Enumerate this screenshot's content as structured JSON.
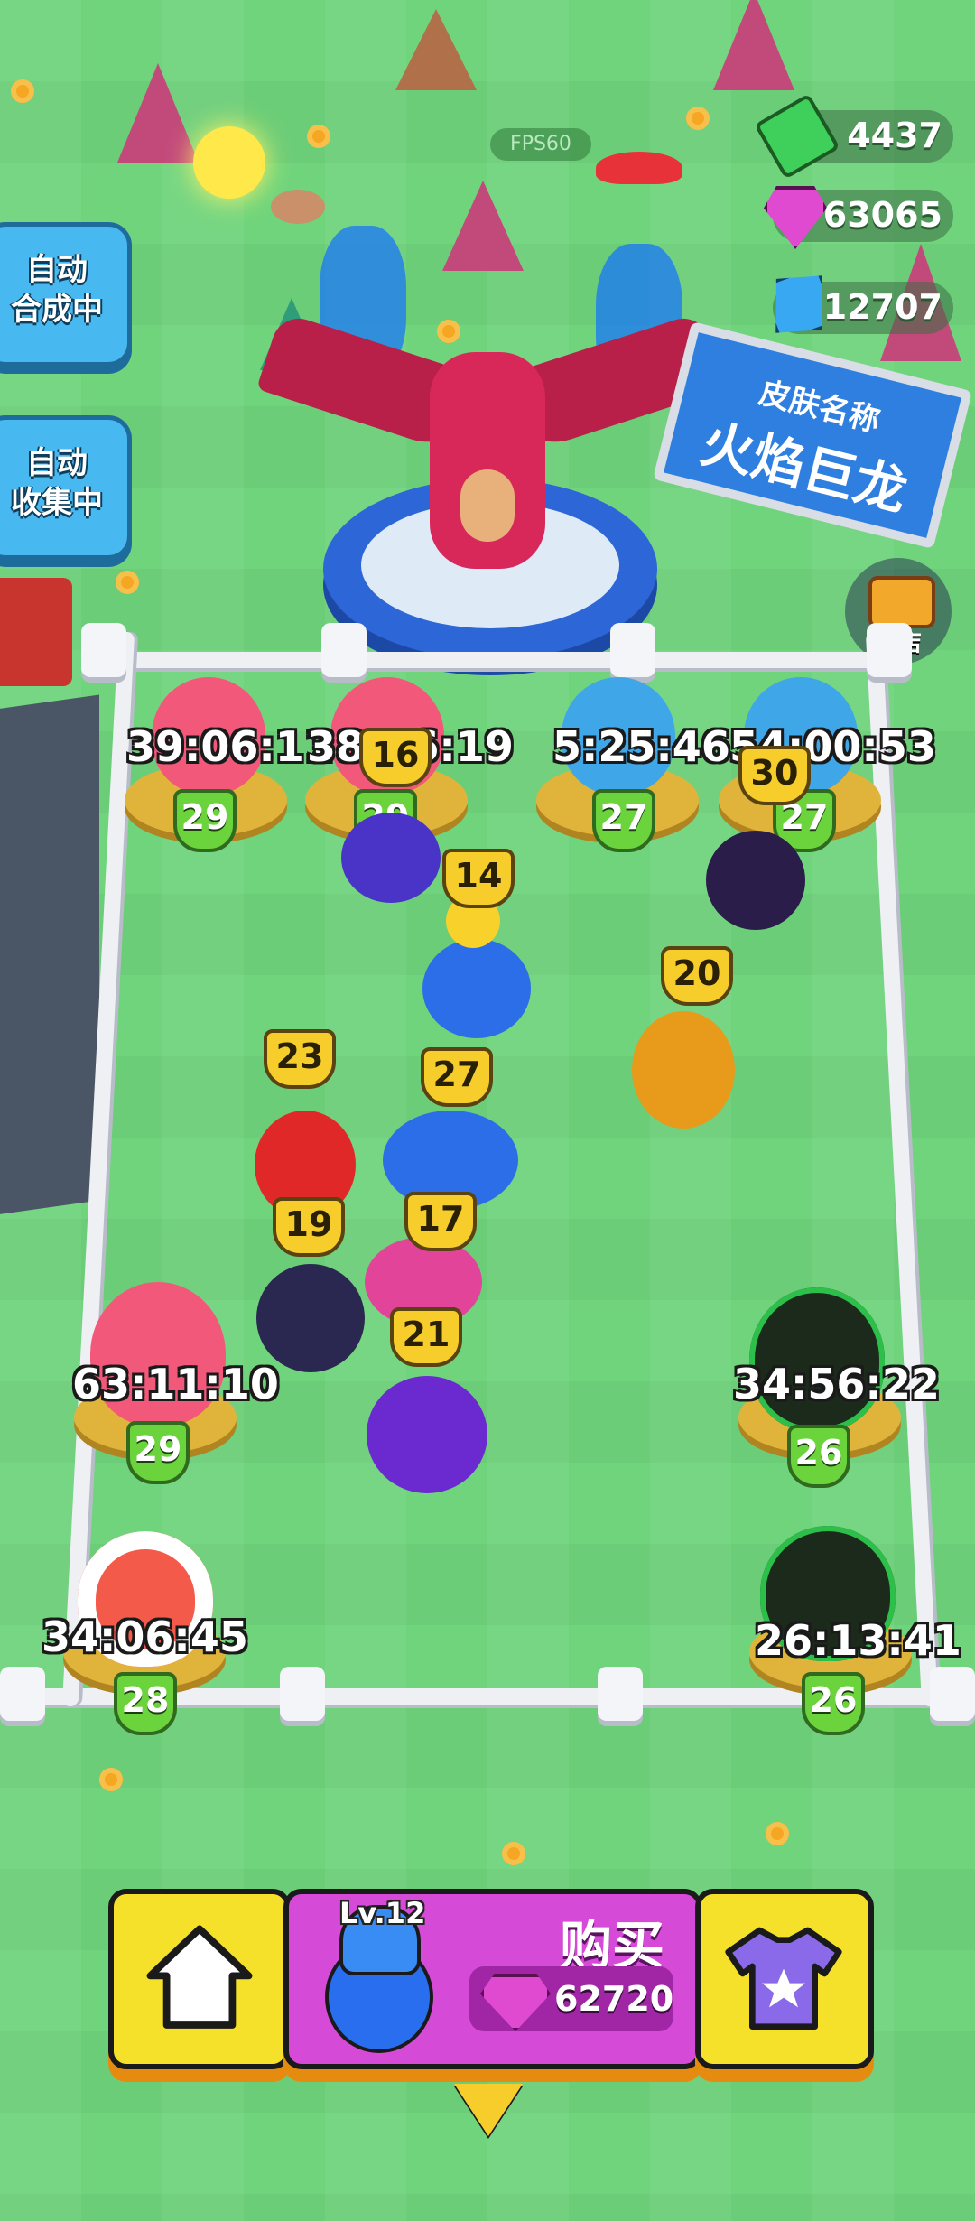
{
  "hud": {
    "fps": "FPS60",
    "cash": "4437",
    "pink_gems": "63065",
    "blue_crystals": "12707",
    "cash_icon": "cash-icon",
    "pink_gem_icon": "pink-gem-icon",
    "blue_crystal_icon": "blue-crystal-icon"
  },
  "side_buttons": {
    "auto_merge": "自动\n合成中",
    "auto_collect": "自动\n收集中"
  },
  "skin_board": {
    "label": "皮肤名称",
    "name": "火焰巨龙"
  },
  "shop": {
    "label": "商店"
  },
  "eggs": [
    {
      "timer": "39:06:11",
      "level": "29",
      "color": "#f2587a"
    },
    {
      "timer": "38:16:19",
      "level": "29",
      "color": "#f2587a"
    },
    {
      "timer": "5:25:46",
      "level": "27",
      "color": "#3fa6e8"
    },
    {
      "timer": "54:00:53",
      "level": "27",
      "color": "#3fa6e8"
    },
    {
      "timer": "63:11:10",
      "level": "29",
      "color": "#f2587a"
    },
    {
      "timer": "34:56:22",
      "level": "26",
      "color": "#1c2a1c"
    },
    {
      "timer": "34:06:45",
      "level": "28",
      "color": "#f45a4a"
    },
    {
      "timer": "26:13:41",
      "level": "26",
      "color": "#1c2a1c"
    }
  ],
  "pets": [
    {
      "level": "16"
    },
    {
      "level": "30"
    },
    {
      "level": "14"
    },
    {
      "level": "20"
    },
    {
      "level": "23"
    },
    {
      "level": "27"
    },
    {
      "level": "19"
    },
    {
      "level": "17"
    },
    {
      "level": "21"
    }
  ],
  "bottom_bar": {
    "home_icon": "home-icon",
    "level": "Lv.12",
    "buy_label": "购买",
    "price": "62720",
    "shirt_icon": "shirt-icon",
    "collapse_icon": "chevron-down-icon"
  },
  "colors": {
    "yellow": "#f6e12a",
    "buy_purple": "#d64ad8",
    "grass": "#70d47c"
  }
}
